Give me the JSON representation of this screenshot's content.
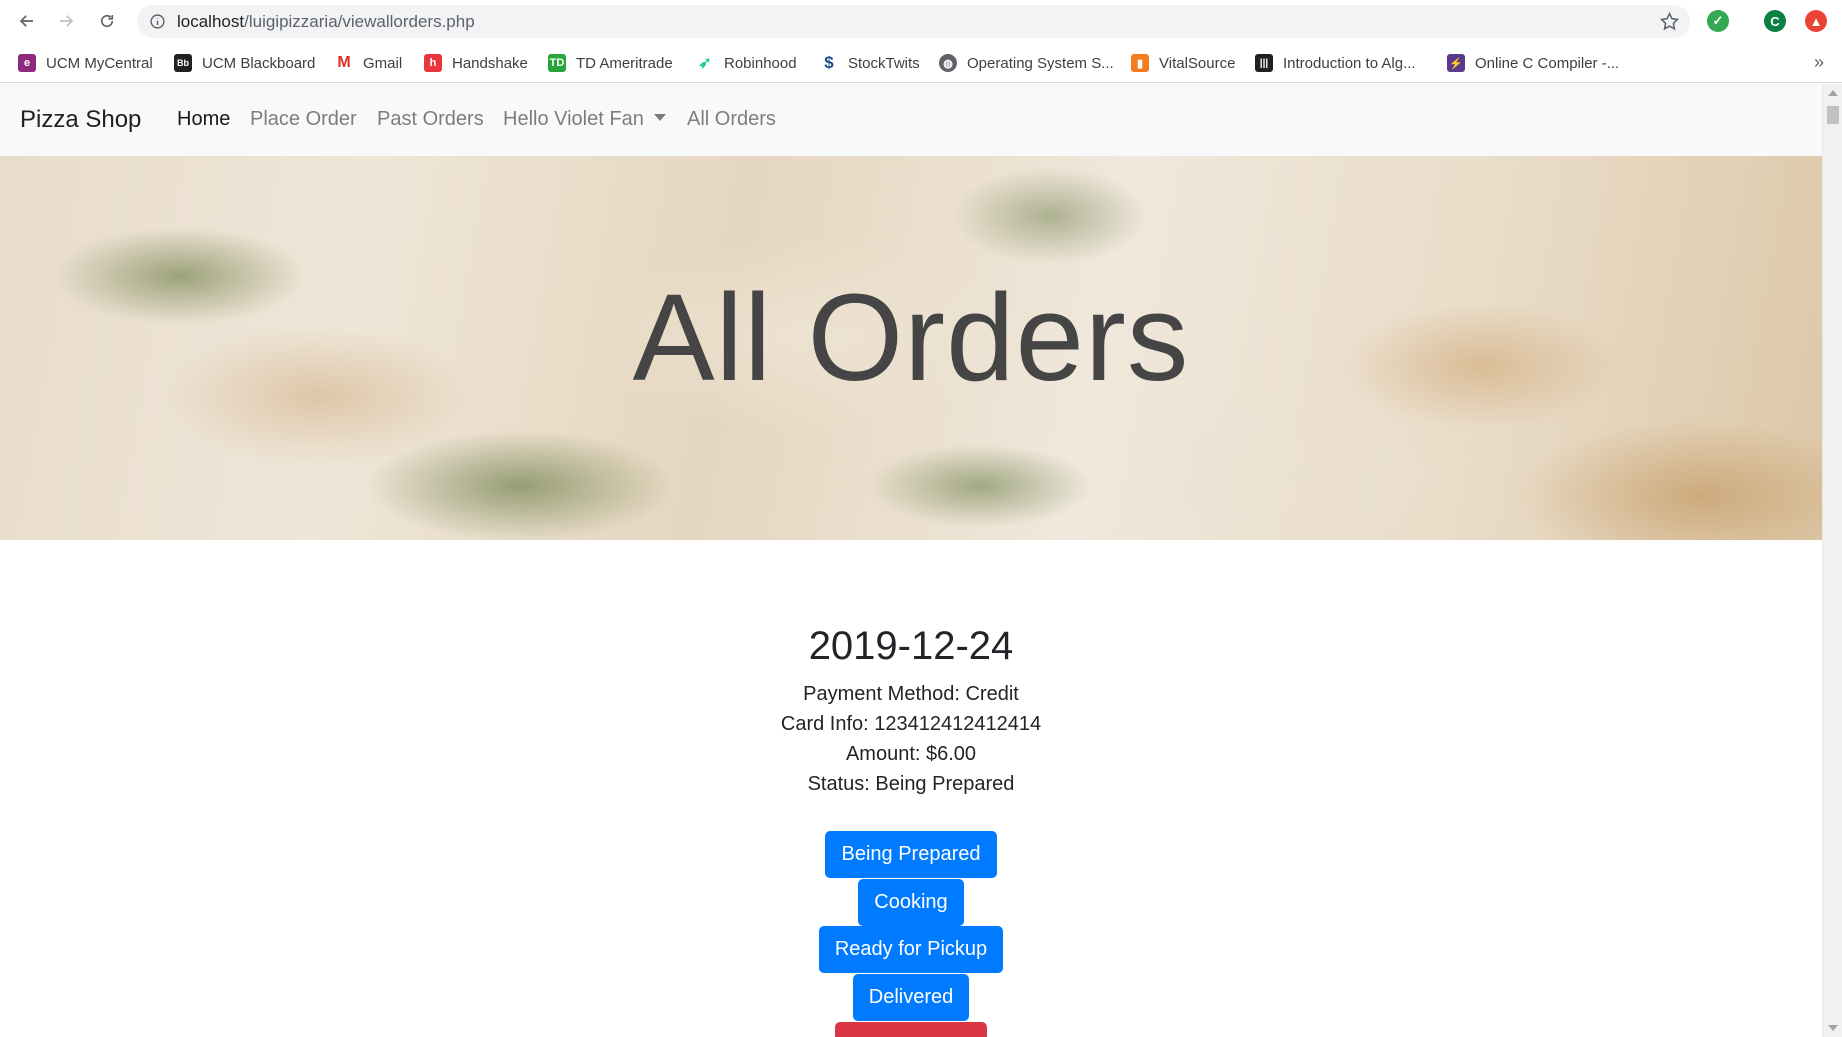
{
  "browser": {
    "url_host": "localhost",
    "url_path": "/luigipizzaria/viewallorders.php",
    "bookmarks": [
      {
        "label": "UCM MyCentral",
        "icon": "ucm-mycentral-icon",
        "color": "#8e2a7d"
      },
      {
        "label": "UCM Blackboard",
        "icon": "blackboard-icon",
        "color": "#222222"
      },
      {
        "label": "Gmail",
        "icon": "gmail-icon",
        "color": "#d93025"
      },
      {
        "label": "Handshake",
        "icon": "handshake-icon",
        "color": "#e8363c"
      },
      {
        "label": "TD Ameritrade",
        "icon": "td-ameritrade-icon",
        "color": "#2aa53b"
      },
      {
        "label": "Robinhood",
        "icon": "robinhood-icon",
        "color": "#21ce99"
      },
      {
        "label": "StockTwits",
        "icon": "stocktwits-icon",
        "color": "#1d4f91"
      },
      {
        "label": "Operating System S...",
        "icon": "globe-icon",
        "color": "#5f6368"
      },
      {
        "label": "VitalSource",
        "icon": "vitalsource-icon",
        "color": "#f47b20"
      },
      {
        "label": "Introduction to Alg...",
        "icon": "barcode-icon",
        "color": "#222222"
      },
      {
        "label": "Online C Compiler -...",
        "icon": "onlinegdb-icon",
        "color": "#5b3a8c"
      }
    ],
    "more_label": "»",
    "profile_initial": "C"
  },
  "navbar": {
    "brand": "Pizza Shop",
    "links": [
      "Home",
      "Place Order",
      "Past Orders",
      "Hello Violet Fan",
      "All Orders"
    ]
  },
  "hero": {
    "title": "All Orders"
  },
  "order": {
    "date": "2019-12-24",
    "payment_method": "Payment Method: Credit",
    "card_info": "Card Info: 123412412412414",
    "amount": "Amount: $6.00",
    "status": "Status: Being Prepared",
    "buttons": [
      "Being Prepared",
      "Cooking",
      "Ready for Pickup",
      "Delivered"
    ]
  },
  "colors": {
    "primary": "#007bff",
    "danger": "#dc3545",
    "navbar_bg": "#f8f9fa"
  }
}
